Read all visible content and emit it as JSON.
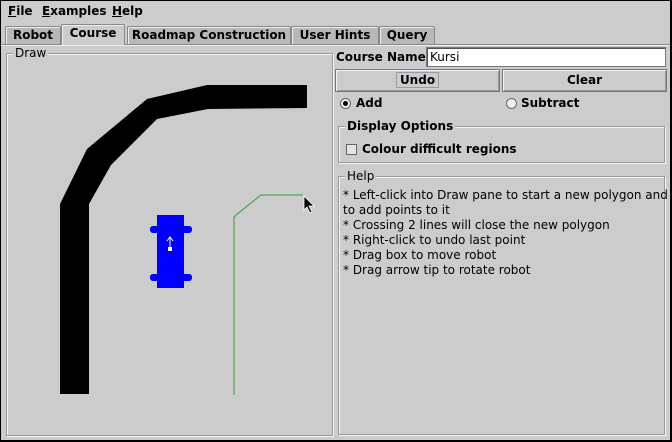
{
  "menu": [
    {
      "mnemonic": "F",
      "rest": "ile"
    },
    {
      "mnemonic": "E",
      "rest": "xamples"
    },
    {
      "mnemonic": "H",
      "rest": "elp"
    }
  ],
  "tabs": [
    {
      "label": "Robot",
      "active": false
    },
    {
      "label": "Course",
      "active": true
    },
    {
      "label": "Roadmap Construction",
      "active": false
    },
    {
      "label": "User Hints",
      "active": false
    },
    {
      "label": "Query",
      "active": false
    }
  ],
  "draw": {
    "title": "Draw"
  },
  "course": {
    "label": "Course Name:",
    "value": "Kursi"
  },
  "buttons": {
    "undo": "Undo",
    "clear": "Clear"
  },
  "mode": {
    "add": "Add",
    "subtract": "Subtract",
    "selected": "add"
  },
  "display_options": {
    "title": "Display Options",
    "colour_difficult": {
      "label": "Colour difficult regions",
      "checked": false
    }
  },
  "help": {
    "title": "Help",
    "lines": [
      "* Left-click into Draw pane to start a new polygon and",
      "to add points to it",
      "* Crossing 2 lines will close the new polygon",
      "* Right-click to undo last point",
      "* Drag box to move robot",
      "* Drag arrow tip to rotate robot"
    ]
  },
  "colors": {
    "obstacle": "#000000",
    "robot": "#0000ff",
    "path": "#2f9f2f"
  },
  "icons": {
    "cursor": "mouse-pointer-icon",
    "robot": "robot-icon",
    "arrow": "arrow-up-icon"
  }
}
